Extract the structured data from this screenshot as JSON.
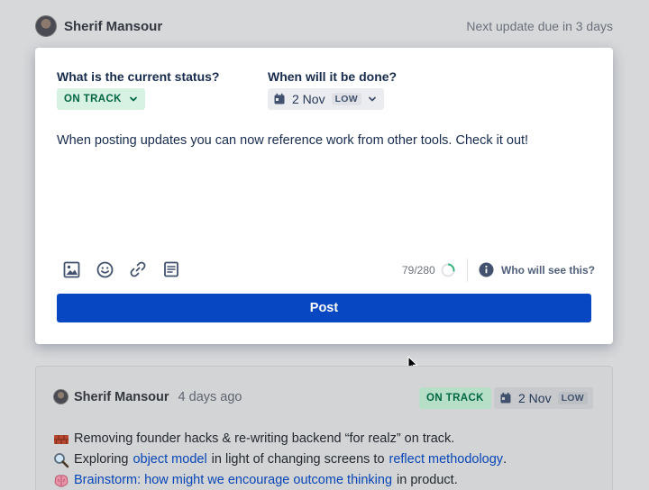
{
  "header": {
    "user_name": "Sherif Mansour",
    "next_update": "Next update due in 3 days"
  },
  "composer": {
    "status_question": "What is the current status?",
    "date_question": "When will it be done?",
    "status_value": "ON TRACK",
    "date_value": "2 Nov",
    "date_confidence": "LOW",
    "body": "When posting updates you can now reference work from other tools. Check it out!",
    "char_count": "79/280",
    "char_progress": 0.282,
    "who_will_see": "Who will see this?",
    "post_label": "Post",
    "tools": [
      "image-icon",
      "emoji-icon",
      "link-icon",
      "document-icon"
    ]
  },
  "feed": {
    "user_name": "Sherif Mansour",
    "time_ago": "4 days ago",
    "status": "ON TRACK",
    "date": "2 Nov",
    "date_confidence": "LOW",
    "lines": [
      {
        "emoji": "brick-icon",
        "parts": [
          {
            "text": "Removing founder hacks & re-writing backend “for realz” on track.",
            "link": false
          }
        ]
      },
      {
        "emoji": "magnifier-icon",
        "parts": [
          {
            "text": "Exploring",
            "link": false
          },
          {
            "text": "object model",
            "link": true
          },
          {
            "text": "in light of changing screens to",
            "link": false
          },
          {
            "text": "reflect methodology",
            "link": true
          },
          {
            "text": ".",
            "link": false
          }
        ]
      },
      {
        "emoji": "brain-icon",
        "parts": [
          {
            "text": "Brainstorm: how might we encourage outcome thinking",
            "link": true
          },
          {
            "text": "in product.",
            "link": false
          }
        ]
      }
    ]
  },
  "colors": {
    "primary": "#0747c2",
    "on_track_bg": "#d7f2e2",
    "on_track_text": "#006644",
    "link": "#0846b6"
  }
}
